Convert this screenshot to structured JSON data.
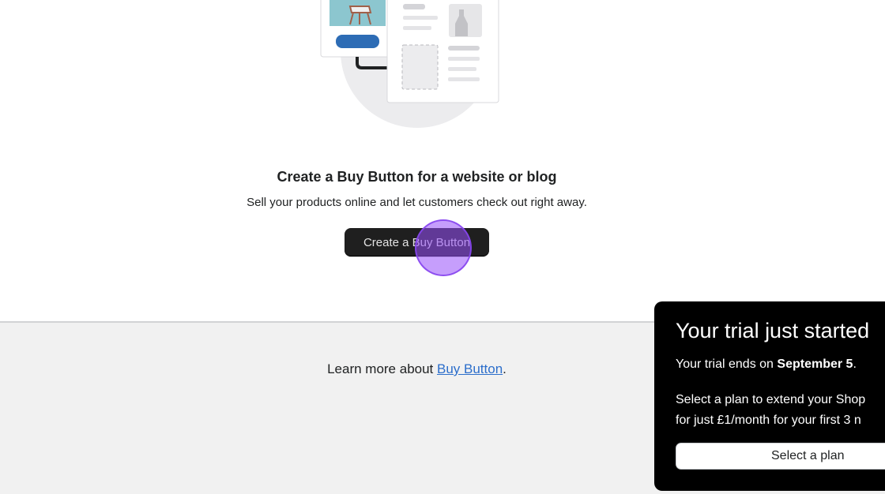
{
  "empty_state": {
    "title": "Create a Buy Button for a website or blog",
    "description": "Sell your products online and let customers check out right away.",
    "cta_label": "Create a Buy Button"
  },
  "footer": {
    "learn_prefix": "Learn more about ",
    "learn_link": "Buy Button",
    "learn_suffix": "."
  },
  "trial_popover": {
    "title": "Your trial just started",
    "ends_prefix": "Your trial ends on ",
    "ends_date": "September 5",
    "ends_suffix": ".",
    "desc_line1": "Select a plan to extend your Shop",
    "desc_line2": "for just £1/month for your first 3 n",
    "button_label": "Select a plan"
  },
  "colors": {
    "accent_link": "#2c6ecb",
    "primary_button": "#1f1f1f",
    "cursor_highlight": "#984ffa",
    "illustration_blue": "#2d6cb5"
  }
}
